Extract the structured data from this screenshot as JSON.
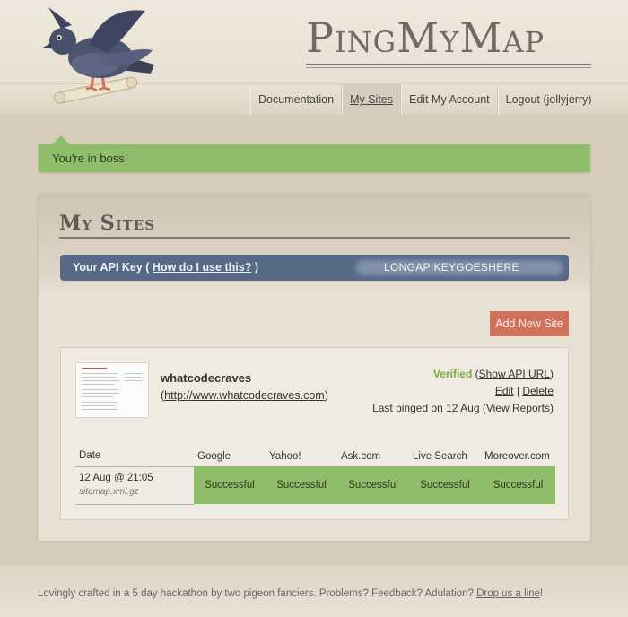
{
  "brand": {
    "logo_text": "PingMyMap"
  },
  "nav": [
    {
      "label": "Documentation",
      "active": false
    },
    {
      "label": "My Sites",
      "active": true
    },
    {
      "label": "Edit My Account",
      "active": false
    },
    {
      "label": "Logout (jollyjerry)",
      "active": false
    }
  ],
  "flash": {
    "message": "You're in boss!"
  },
  "page": {
    "title": "My Sites"
  },
  "api_key": {
    "label": "Your API Key (",
    "help_link": "How do I use this?",
    "label_close": ")",
    "value": "LONGAPIKEYGOESHERE"
  },
  "add_site_button": "Add New Site",
  "site": {
    "name": "whatcodecraves",
    "url_open": "(",
    "url": "http://www.whatcodecraves.com",
    "url_close": ")",
    "verified": "Verified",
    "show_api_url_open": "(",
    "show_api_url": "Show API URL",
    "show_api_url_close": ")",
    "edit": "Edit",
    "separator": "|",
    "delete": "Delete",
    "last_pinged_prefix": "Last pinged on 12 Aug (",
    "view_reports": "View Reports",
    "last_pinged_suffix": ")"
  },
  "pings": {
    "headers": [
      "Date",
      "Google",
      "Yahoo!",
      "Ask.com",
      "Live Search",
      "Moreover.com"
    ],
    "rows": [
      {
        "date": "12 Aug @ 21:05",
        "file": "sitemap.xml.gz",
        "statuses": [
          "Successful",
          "Successful",
          "Successful",
          "Successful",
          "Successful"
        ]
      }
    ]
  },
  "footer": {
    "text": "Lovingly crafted in a 5 day hackathon by two pigeon fanciers. Problems? Feedback? Adulation?",
    "link": "Drop us a line",
    "suffix": "!"
  },
  "colors": {
    "flash": "#8fbe6a",
    "api_bar": "#566a87",
    "add_button": "#d0715c",
    "verified": "#7cab42"
  }
}
